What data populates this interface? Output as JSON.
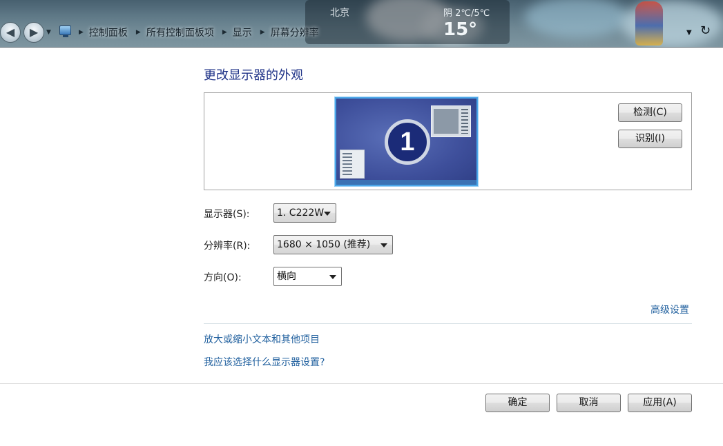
{
  "address_bar": {
    "breadcrumbs": [
      "控制面板",
      "所有控制面板项",
      "显示",
      "屏幕分辨率"
    ],
    "weather_city": "北京",
    "weather_range": "阴 2℃/5℃",
    "weather_temp": "15°"
  },
  "main": {
    "title": "更改显示器的外观",
    "monitor_number": "1",
    "detect_label": "检测(C)",
    "identify_label": "识别(I)",
    "fields": {
      "display_label": "显示器(S):",
      "display_value": "1. C222W",
      "resolution_label": "分辨率(R):",
      "resolution_value": "1680 × 1050 (推荐)",
      "orientation_label": "方向(O):",
      "orientation_value": "横向"
    },
    "advanced_link": "高级设置",
    "links": [
      "放大或缩小文本和其他项目",
      "我应该选择什么显示器设置?"
    ]
  },
  "footer": {
    "ok_label": "确定",
    "cancel_label": "取消",
    "apply_label": "应用(A)"
  }
}
